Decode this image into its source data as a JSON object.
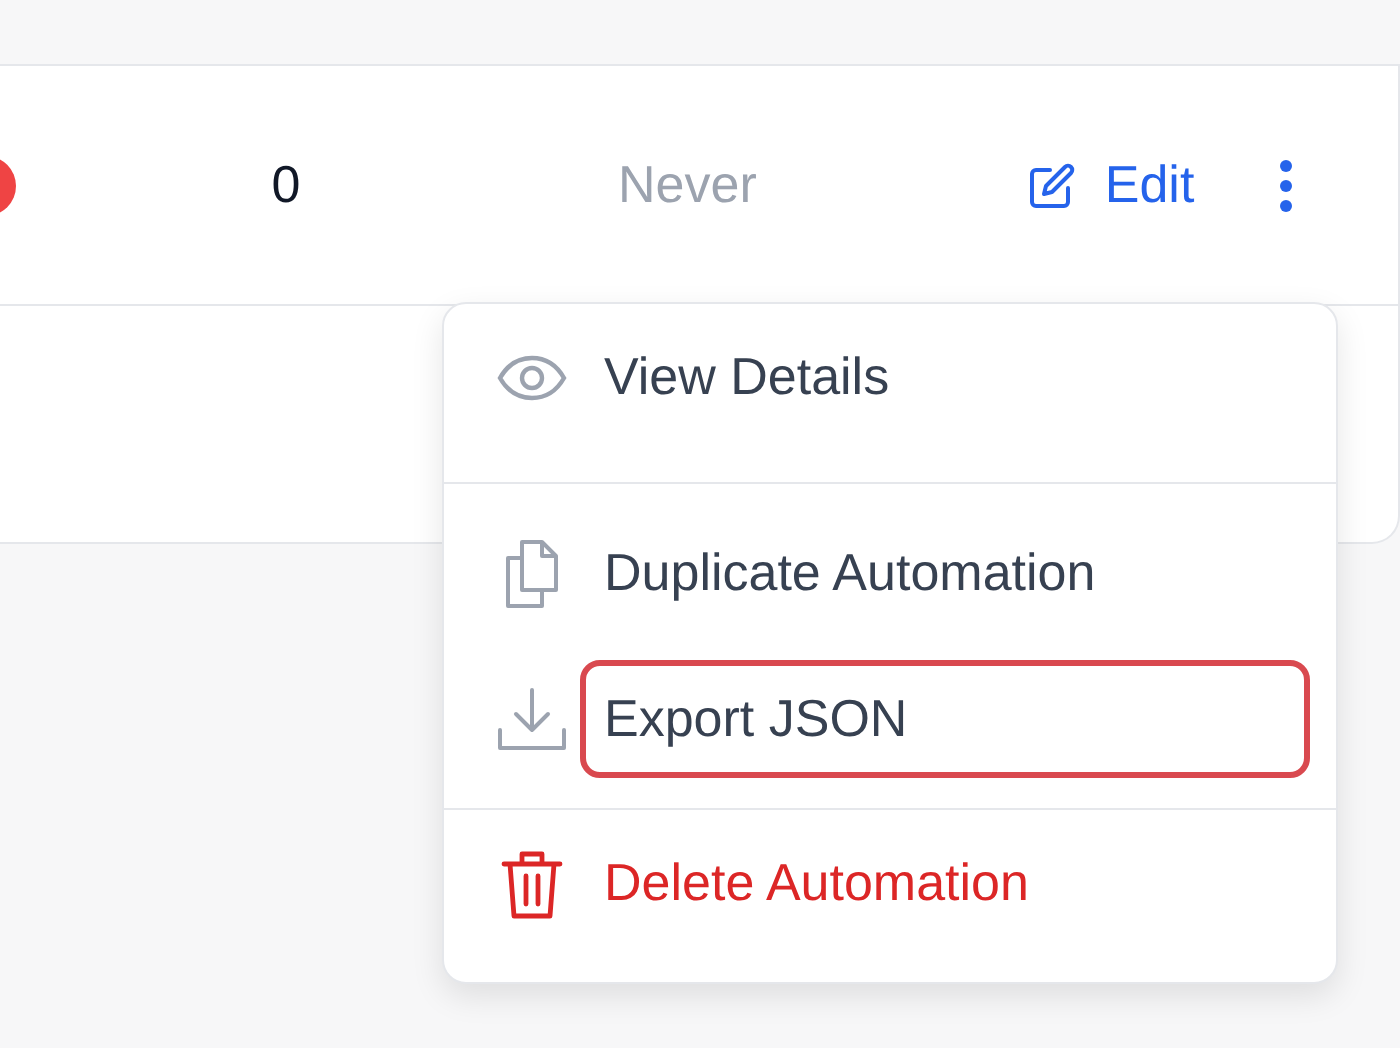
{
  "row": {
    "status": {
      "color": "#ef4444"
    },
    "count": "0",
    "last_run": "Never",
    "edit_label": "Edit"
  },
  "menu": {
    "groups": [
      [
        {
          "kind": "view",
          "label": "View Details",
          "danger": false,
          "highlighted": false
        }
      ],
      [
        {
          "kind": "duplicate",
          "label": "Duplicate Automation",
          "danger": false,
          "highlighted": false
        },
        {
          "kind": "export",
          "label": "Export JSON",
          "danger": false,
          "highlighted": true
        }
      ],
      [
        {
          "kind": "delete",
          "label": "Delete Automation",
          "danger": true,
          "highlighted": false
        }
      ]
    ]
  }
}
